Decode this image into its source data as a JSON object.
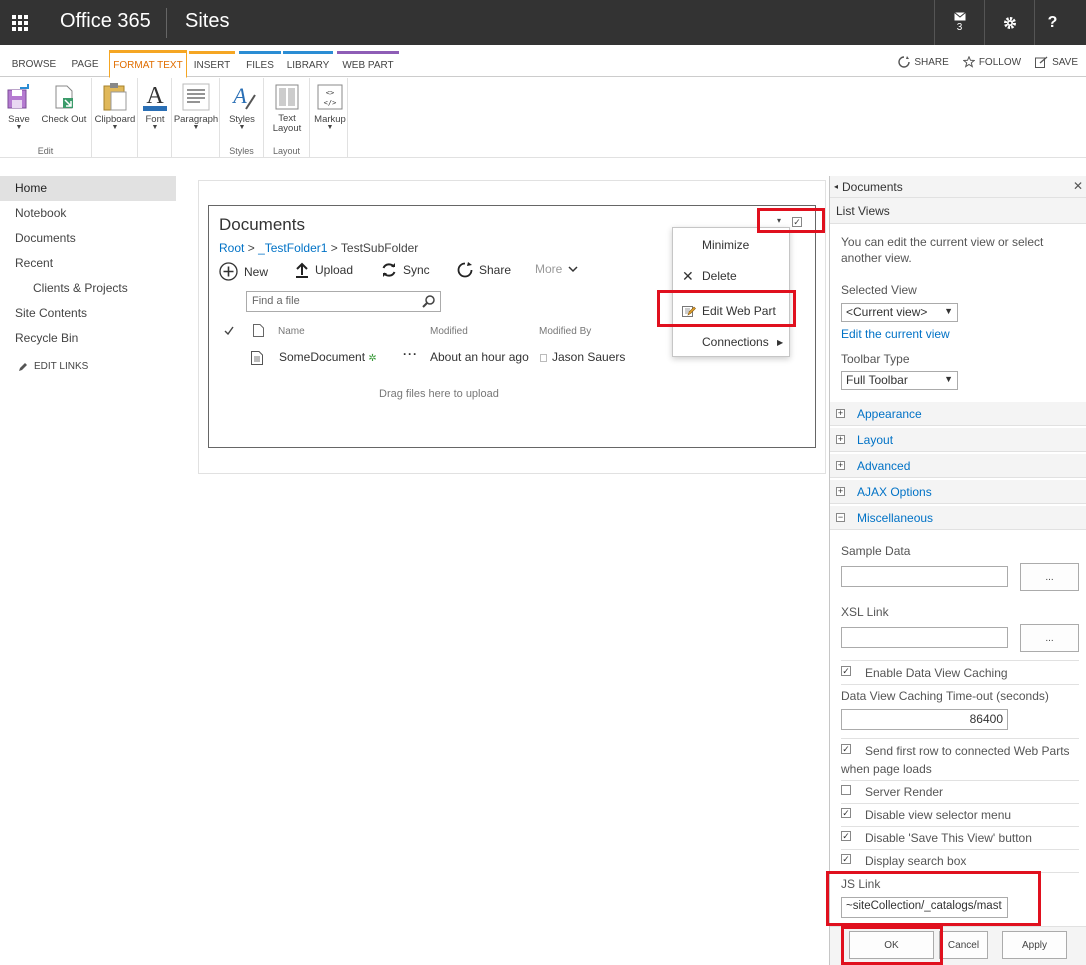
{
  "suitebar": {
    "brand": "Office 365",
    "app": "Sites",
    "mail_count": "3",
    "help": "?"
  },
  "ribbon": {
    "tabs": [
      "BROWSE",
      "PAGE",
      "FORMAT TEXT",
      "INSERT",
      "FILES",
      "LIBRARY",
      "WEB PART"
    ],
    "actions": {
      "share": "SHARE",
      "follow": "FOLLOW",
      "save": "SAVE"
    },
    "buttons": {
      "save": "Save",
      "checkout": "Check Out",
      "clipboard": "Clipboard",
      "font": "Font",
      "paragraph": "Paragraph",
      "styles": "Styles",
      "text_layout_1": "Text",
      "text_layout_2": "Layout",
      "markup": "Markup"
    },
    "groups": {
      "edit": "Edit",
      "styles": "Styles",
      "layout": "Layout"
    }
  },
  "nav": {
    "items": [
      "Home",
      "Notebook",
      "Documents",
      "Recent",
      "Clients & Projects",
      "Site Contents",
      "Recycle Bin"
    ],
    "edit_links": "EDIT LINKS"
  },
  "webpart": {
    "title": "Documents",
    "breadcrumb": {
      "root": "Root",
      "sep": ">",
      "folder": "_TestFolder1",
      "sub": "TestSubFolder"
    },
    "commands": {
      "new": "New",
      "upload": "Upload",
      "sync": "Sync",
      "share": "Share",
      "more": "More"
    },
    "search_placeholder": "Find a file",
    "columns": {
      "name": "Name",
      "modified": "Modified",
      "modified_by": "Modified By"
    },
    "row": {
      "name": "SomeDocument",
      "modified": "About an hour ago",
      "modified_by": "Jason Sauers"
    },
    "drag_text": "Drag files here to upload"
  },
  "wp_menu": {
    "minimize": "Minimize",
    "delete": "Delete",
    "edit": "Edit Web Part",
    "connections": "Connections"
  },
  "toolpane": {
    "header": "Documents",
    "list_views": {
      "title": "List Views",
      "desc_1": "You can edit the current view or select",
      "desc_2": "another view.",
      "selected_view_label": "Selected View",
      "selected_view": "<Current view>",
      "edit_current_view": "Edit the current view",
      "toolbar_type_label": "Toolbar Type",
      "toolbar_type": "Full Toolbar"
    },
    "sections": [
      "Appearance",
      "Layout",
      "Advanced",
      "AJAX Options",
      "Miscellaneous"
    ],
    "misc": {
      "sample_data": "Sample Data",
      "xsl_link": "XSL Link",
      "browse": "...",
      "enable_caching": "Enable Data View Caching",
      "caching_timeout_label": "Data View Caching Time-out (seconds)",
      "caching_timeout": "86400",
      "send_first_row_1": "Send first row to connected Web Parts",
      "send_first_row_2": "when page loads",
      "server_render": "Server Render",
      "disable_view_selector": "Disable view selector menu",
      "disable_save_view": "Disable 'Save This View' button",
      "display_search": "Display search box",
      "js_link_label": "JS Link",
      "js_link": "~siteCollection/_catalogs/mast"
    },
    "buttons": {
      "ok": "OK",
      "cancel": "Cancel",
      "apply": "Apply"
    }
  }
}
